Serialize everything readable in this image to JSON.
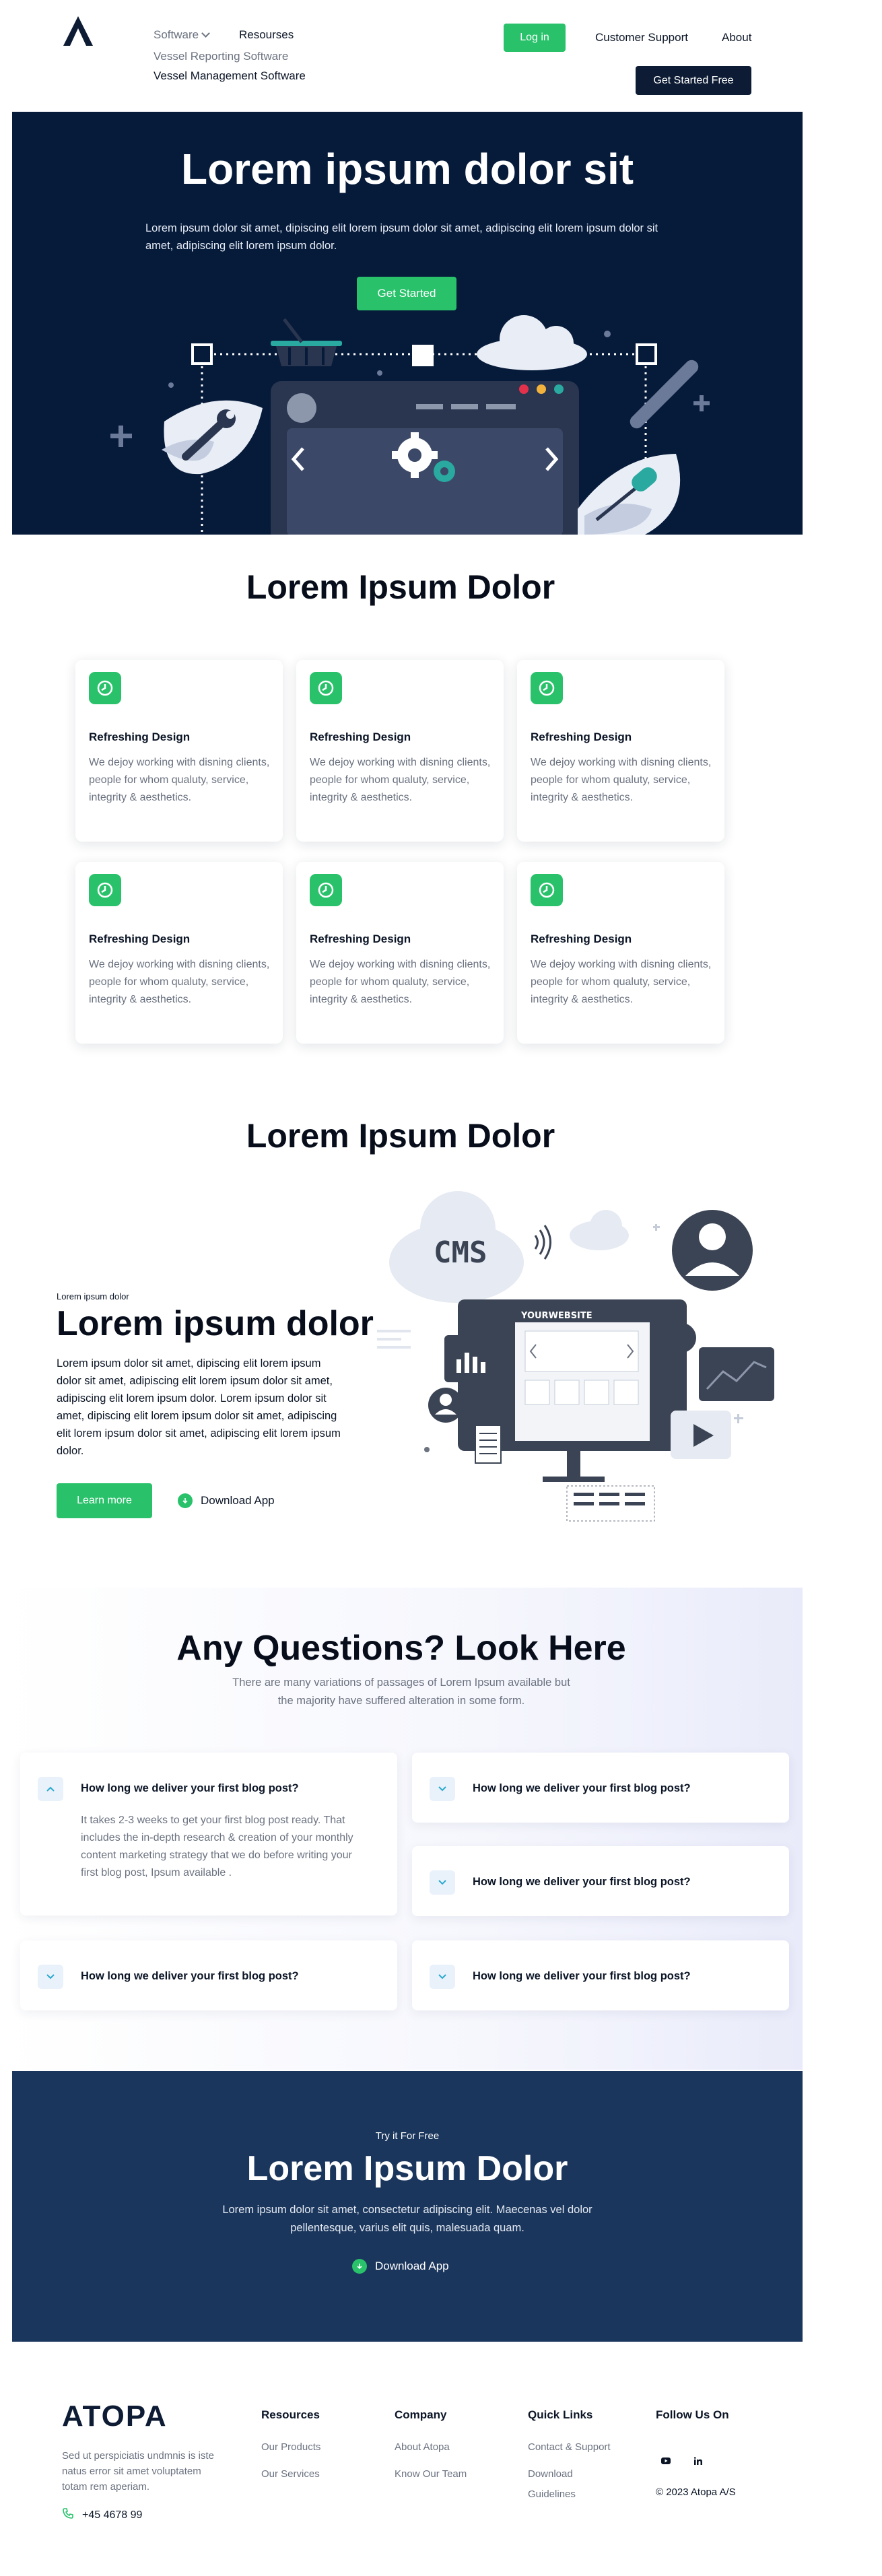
{
  "nav": {
    "software": "Software",
    "resources": "Resourses",
    "submenu": [
      "Vessel Reporting Software",
      "Vessel Management Software"
    ],
    "login": "Log in",
    "support": "Customer Support",
    "about": "About",
    "get_started": "Get Started Free"
  },
  "hero": {
    "title": "Lorem ipsum dolor sit",
    "text": "Lorem ipsum dolor sit amet, dipiscing elit lorem ipsum dolor sit amet, adipiscing elit lorem ipsum dolor sit amet, adipiscing elit lorem ipsum dolor.",
    "button": "Get Started"
  },
  "features": {
    "title": "Lorem Ipsum Dolor",
    "cards": [
      {
        "title": "Refreshing Design",
        "text": "We dejoy working with disning clients, people for whom qualuty, service, integrity & aesthetics."
      },
      {
        "title": "Refreshing Design",
        "text": "We dejoy working with disning clients, people for whom qualuty, service, integrity & aesthetics."
      },
      {
        "title": "Refreshing Design",
        "text": "We dejoy working with disning clients, people for whom qualuty, service, integrity & aesthetics."
      },
      {
        "title": "Refreshing Design",
        "text": "We dejoy working with disning clients, people for whom qualuty, service, integrity & aesthetics."
      },
      {
        "title": "Refreshing Design",
        "text": "We dejoy working with disning clients, people for whom qualuty, service, integrity & aesthetics."
      },
      {
        "title": "Refreshing Design",
        "text": "We dejoy working with disning clients, people for whom qualuty, service, integrity & aesthetics."
      }
    ]
  },
  "cms": {
    "section_title": "Lorem Ipsum Dolor",
    "small": "Lorem ipsum dolor",
    "title": "Lorem ipsum dolor",
    "text": "Lorem ipsum dolor sit amet, dipiscing elit lorem ipsum dolor sit amet, adipiscing elit lorem ipsum dolor sit amet, adipiscing elit lorem ipsum dolor. Lorem ipsum dolor sit amet, dipiscing elit lorem ipsum dolor sit amet, adipiscing elit lorem ipsum dolor sit amet, adipiscing elit lorem ipsum dolor.",
    "learn_more": "Learn more",
    "download": "Download App",
    "art_cms": "CMS",
    "art_website": "YOURWEBSITE"
  },
  "faq": {
    "title": "Any Questions? Look Here",
    "subtitle": "There are many variations of passages of Lorem Ipsum available but the majority have suffered alteration in some form.",
    "items": [
      {
        "q": "How long we deliver your first blog post?",
        "a": "It takes 2-3 weeks to get your first blog post ready. That includes the in-depth research & creation of your monthly content marketing strategy that we do before writing your first blog post,  Ipsum available .",
        "open": true
      },
      {
        "q": "How long we deliver your first blog post?",
        "a": "",
        "open": false
      },
      {
        "q": "How long we deliver your first blog post?",
        "a": "",
        "open": false
      },
      {
        "q": "How long we deliver your first blog post?",
        "a": "",
        "open": false
      },
      {
        "q": "How long we deliver your first blog post?",
        "a": "",
        "open": false
      }
    ]
  },
  "cta": {
    "small": "Try it For Free",
    "title": "Lorem Ipsum Dolor",
    "text": "Lorem ipsum dolor sit amet, consectetur adipiscing elit. Maecenas vel dolor pellentesque, varius elit quis, malesuada quam.",
    "download": "Download App"
  },
  "footer": {
    "logo": "ATOPA",
    "desc": "Sed ut perspiciatis undmnis is iste natus error sit amet voluptatem totam rem aperiam.",
    "phone": "+45 4678 99",
    "resources": {
      "title": "Resources",
      "links": [
        "Our Products",
        "Our Services"
      ]
    },
    "company": {
      "title": "Company",
      "links": [
        "About Atopa",
        "Know Our Team"
      ]
    },
    "quick": {
      "title": "Quick Links",
      "links": [
        "Contact & Support",
        "Download",
        "Guidelines"
      ]
    },
    "follow": {
      "title": "Follow Us On",
      "copyright": "© 2023 Atopa A/S",
      "icons": [
        "youtube-icon",
        "linkedin-icon"
      ]
    }
  },
  "colors": {
    "navy": "#061a3a",
    "green": "#29c26b",
    "cta": "#1b365c"
  }
}
